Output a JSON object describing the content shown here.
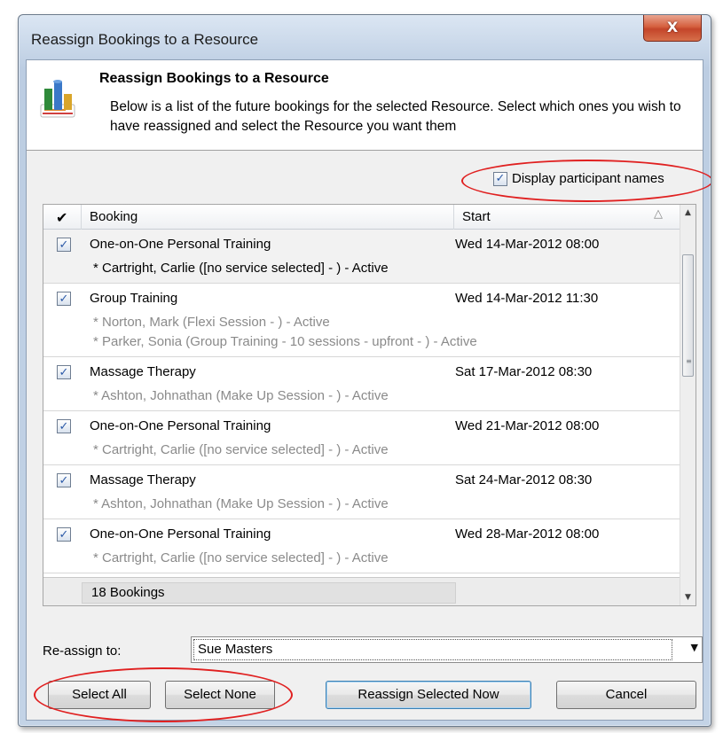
{
  "window": {
    "title": "Reassign Bookings to a Resource",
    "close_glyph": "X"
  },
  "header": {
    "icon": "resource-chart-icon",
    "title": "Reassign Bookings to a Resource",
    "description": "Below is a list of the future bookings for the selected Resource.  Select which ones you wish to have reassigned and select the Resource you want them"
  },
  "display_participants": {
    "label": "Display participant names",
    "checked": true
  },
  "grid": {
    "columns": {
      "select": "✔",
      "booking": "Booking",
      "start": "Start",
      "sort_indicator": "△"
    },
    "bookings": [
      {
        "checked": true,
        "name": "One-on-One Personal Training",
        "start": "Wed 14-Mar-2012 08:00",
        "participants": [
          {
            "text": "* Cartright, Carlie ([no service selected] - ) - Active",
            "dark": true
          }
        ]
      },
      {
        "checked": true,
        "name": "Group Training",
        "start": "Wed 14-Mar-2012 11:30",
        "participants": [
          {
            "text": "* Norton, Mark (Flexi Session - ) - Active",
            "dark": false
          },
          {
            "text": "* Parker, Sonia (Group Training - 10 sessions - upfront - ) - Active",
            "dark": false
          }
        ]
      },
      {
        "checked": true,
        "name": "Massage Therapy",
        "start": "Sat 17-Mar-2012 08:30",
        "participants": [
          {
            "text": "* Ashton, Johnathan (Make Up Session - ) - Active",
            "dark": false
          }
        ]
      },
      {
        "checked": true,
        "name": "One-on-One Personal Training",
        "start": "Wed 21-Mar-2012 08:00",
        "participants": [
          {
            "text": "* Cartright, Carlie ([no service selected] - ) - Active",
            "dark": false
          }
        ]
      },
      {
        "checked": true,
        "name": "Massage Therapy",
        "start": "Sat 24-Mar-2012 08:30",
        "participants": [
          {
            "text": "* Ashton, Johnathan (Make Up Session - ) - Active",
            "dark": false
          }
        ]
      },
      {
        "checked": true,
        "name": "One-on-One Personal Training",
        "start": "Wed 28-Mar-2012 08:00",
        "participants": [
          {
            "text": "* Cartright, Carlie ([no service selected] - ) - Active",
            "dark": false
          }
        ]
      }
    ],
    "footer_count": "18 Bookings"
  },
  "reassign": {
    "label": "Re-assign to:",
    "selected": "Sue Masters"
  },
  "buttons": {
    "select_all": "Select All",
    "select_none": "Select None",
    "reassign_now": "Reassign Selected Now",
    "cancel": "Cancel"
  },
  "colors": {
    "highlight": "#e02020",
    "checkmark": "#2c5aa8",
    "participant_muted": "#8a8a8a"
  }
}
